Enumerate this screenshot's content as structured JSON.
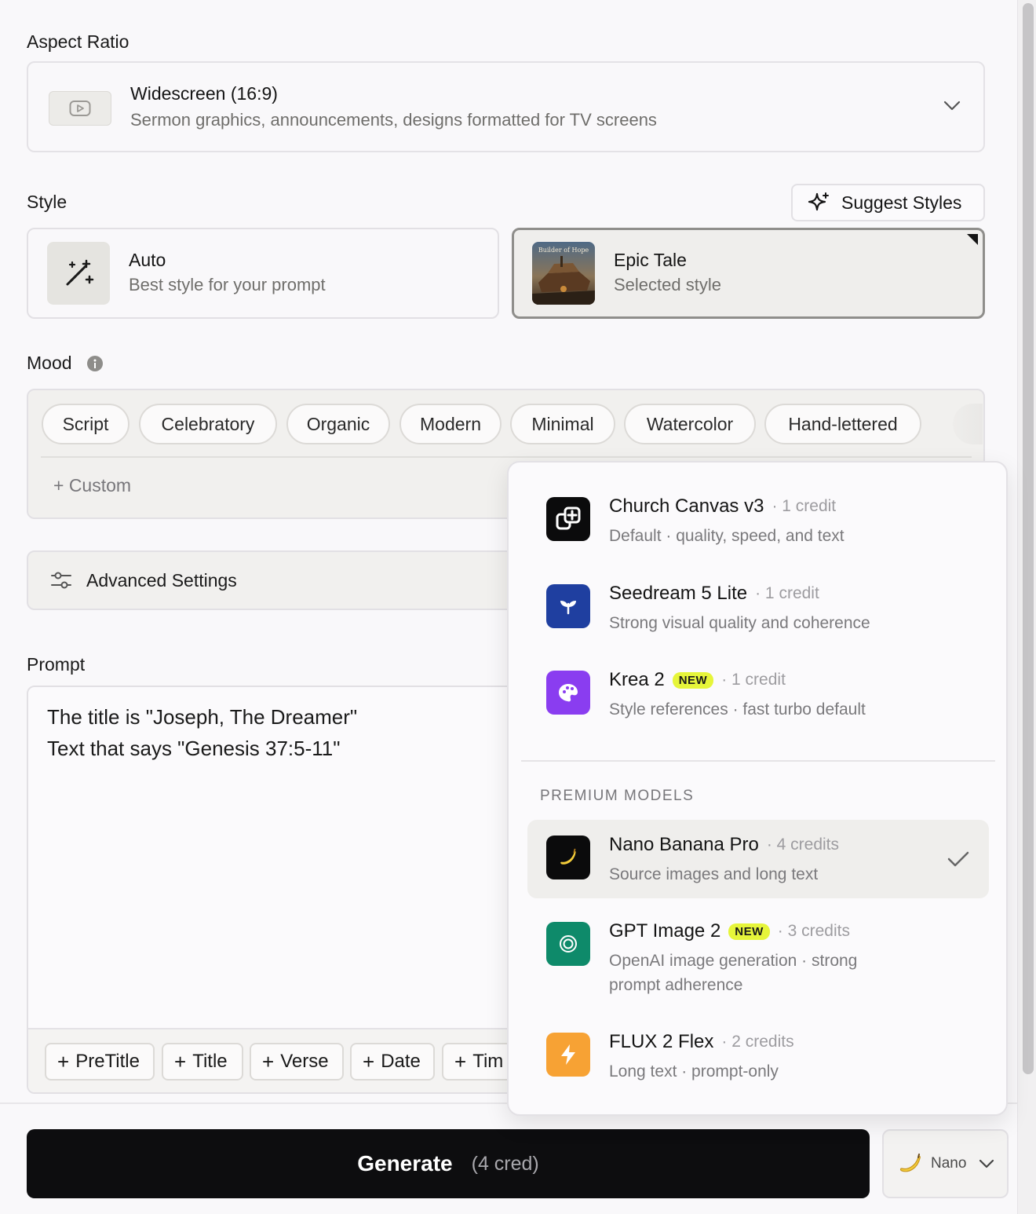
{
  "aspect_ratio": {
    "label": "Aspect Ratio",
    "selected_title": "Widescreen (16:9)",
    "selected_desc": "Sermon graphics, announcements, designs formatted for TV screens"
  },
  "style": {
    "label": "Style",
    "suggest_label": "Suggest Styles",
    "cards": [
      {
        "title": "Auto",
        "desc": "Best style for your prompt"
      },
      {
        "title": "Epic Tale",
        "desc": "Selected style",
        "thumb_text": "Builder of Hope"
      }
    ]
  },
  "mood": {
    "label": "Mood",
    "chips": [
      "Script",
      "Celebratory",
      "Organic",
      "Modern",
      "Minimal",
      "Watercolor",
      "Hand-lettered"
    ],
    "custom_label": "+ Custom"
  },
  "advanced": {
    "label": "Advanced Settings"
  },
  "prompt": {
    "label": "Prompt",
    "lines": [
      "The title is \"Joseph, The Dreamer\"",
      "Text that says \"Genesis 37:5-11\""
    ],
    "tokens": [
      "PreTitle",
      "Title",
      "Verse",
      "Date",
      "Tim"
    ]
  },
  "generate": {
    "label": "Generate",
    "cost": "(4 cred)"
  },
  "model_button": {
    "label": "Nano"
  },
  "models": {
    "standard": [
      {
        "name": "Church Canvas v3",
        "credit": "· 1 credit",
        "desc": "Default · quality, speed, and text",
        "icon": "church-canvas-icon",
        "color": "#0b0b0c"
      },
      {
        "name": "Seedream 5 Lite",
        "credit": "· 1 credit",
        "desc": "Strong visual quality and coherence",
        "icon": "seedream-icon",
        "color": "#1f3fa0"
      },
      {
        "name": "Krea 2",
        "badge": "NEW",
        "credit": "· 1 credit",
        "desc": "Style references · fast turbo default",
        "icon": "krea-icon",
        "color": "#8a3df0"
      }
    ],
    "premium_label": "PREMIUM MODELS",
    "premium": [
      {
        "name": "Nano Banana Pro",
        "credit": "· 4 credits",
        "desc": "Source images and long text",
        "icon": "banana-icon",
        "color": "#0b0b0c",
        "selected": true
      },
      {
        "name": "GPT Image 2",
        "badge": "NEW",
        "credit": "· 3 credits",
        "desc_lines": [
          "OpenAI image generation · strong",
          "prompt adherence"
        ],
        "icon": "openai-icon",
        "color": "#0e8a6a"
      },
      {
        "name": "FLUX 2 Flex",
        "credit": "· 2 credits",
        "desc": "Long text · prompt-only",
        "icon": "flux-icon",
        "color": "#f7a234"
      }
    ]
  }
}
